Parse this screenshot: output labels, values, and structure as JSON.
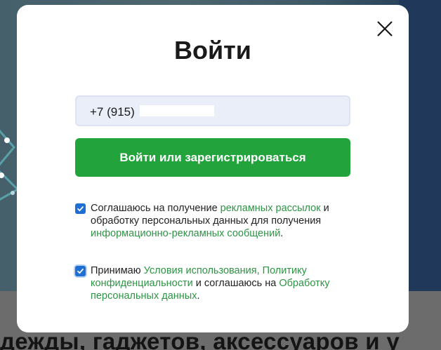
{
  "background": {
    "headline": "дежды, гаджетов, аксессуаров и у"
  },
  "modal": {
    "title": "Войти",
    "close_icon": "close-icon",
    "phone": {
      "value": "+7 (915)"
    },
    "submit_label": "Войти или зарегистрироваться",
    "consents": [
      {
        "checked": true,
        "parts": [
          {
            "text": "Соглашаюсь на получение ",
            "link": false
          },
          {
            "text": "рекламных рассылок",
            "link": true
          },
          {
            "text": " и обработку персональных данных для получения ",
            "link": false
          },
          {
            "text": "информационно-рекламных сообщений",
            "link": true
          },
          {
            "text": ".",
            "link": false
          }
        ]
      },
      {
        "checked": true,
        "parts": [
          {
            "text": "Принимаю ",
            "link": false
          },
          {
            "text": "Условия использования",
            "link": true
          },
          {
            "text": ", ",
            "link": true
          },
          {
            "text": "Политику конфиденциальности",
            "link": true
          },
          {
            "text": " и соглашаюсь на ",
            "link": false
          },
          {
            "text": "Обработку персональных данных",
            "link": true
          },
          {
            "text": ".",
            "link": false
          }
        ]
      }
    ]
  },
  "colors": {
    "primary_green": "#23a33c",
    "link_green": "#2e9445",
    "checkbox_blue": "#1f6ed4",
    "input_bg": "#e9eef9"
  }
}
